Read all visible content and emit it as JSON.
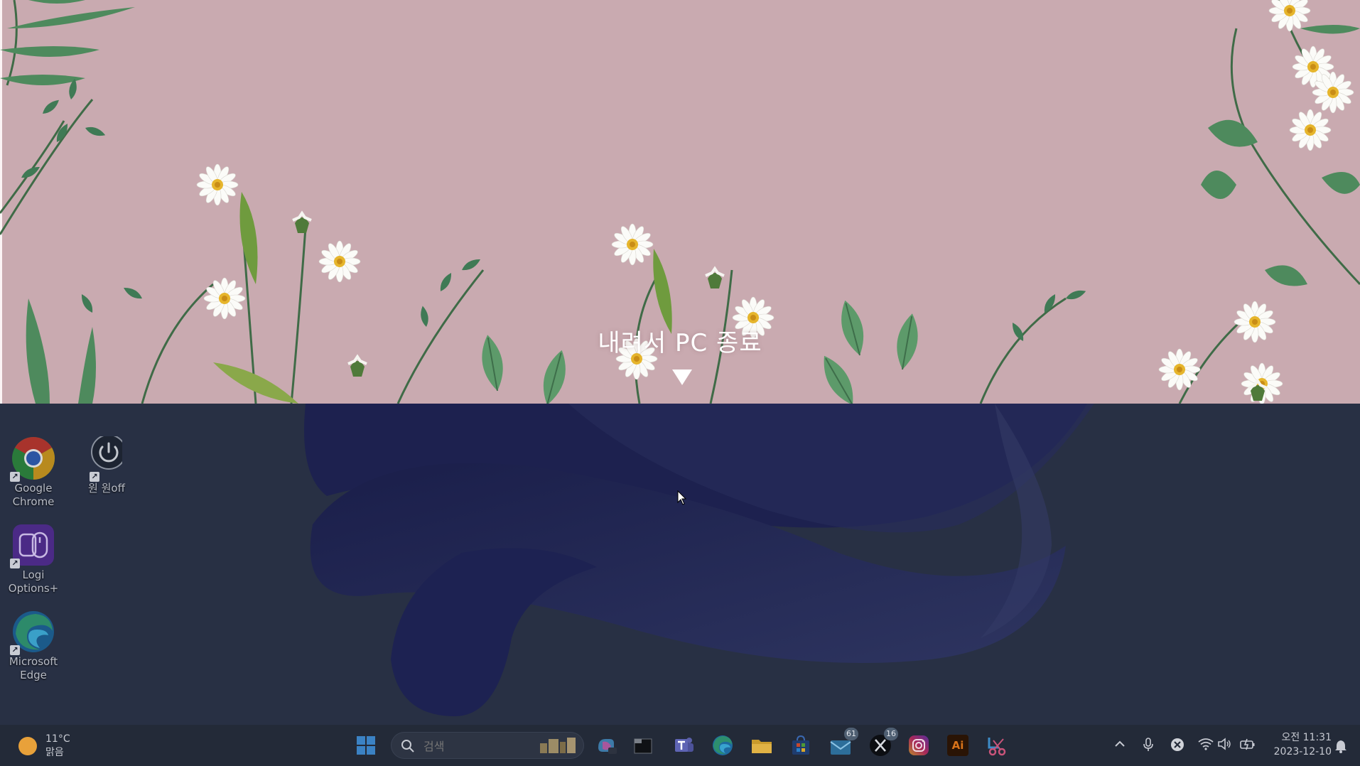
{
  "slide_to_shutdown": {
    "prompt": "내려서 PC 종료"
  },
  "desktop": {
    "icons": [
      {
        "label": "Google Chrome",
        "icon": "chrome-icon"
      },
      {
        "label": "원 원off",
        "icon": "power-icon"
      },
      {
        "label": "Logi Options+",
        "icon": "logi-options-icon"
      },
      {
        "label": "Microsoft Edge",
        "icon": "edge-icon"
      }
    ]
  },
  "taskbar": {
    "weather": {
      "temperature": "11°C",
      "condition": "맑음",
      "icon": "sun-icon"
    },
    "search_placeholder": "검색",
    "apps": [
      {
        "name": "start-button",
        "icon": "windows-logo-icon"
      },
      {
        "name": "copilot-button",
        "icon": "copilot-icon"
      },
      {
        "name": "terminal-button",
        "icon": "terminal-icon"
      },
      {
        "name": "teams-button",
        "icon": "teams-icon"
      },
      {
        "name": "edge-button",
        "icon": "edge-icon"
      },
      {
        "name": "file-explorer-button",
        "icon": "folder-icon"
      },
      {
        "name": "store-button",
        "icon": "store-icon"
      },
      {
        "name": "mail-button",
        "icon": "mail-icon",
        "badge": "61"
      },
      {
        "name": "x-button",
        "icon": "x-icon",
        "badge": "16"
      },
      {
        "name": "instagram-button",
        "icon": "instagram-icon"
      },
      {
        "name": "illustrator-button",
        "icon": "illustrator-icon",
        "label": "Ai"
      },
      {
        "name": "snipping-tool-button",
        "icon": "snipping-icon"
      }
    ],
    "tray": {
      "icons": [
        "chevron-up-icon",
        "microphone-icon",
        "close-circle-icon",
        "wifi-icon",
        "volume-icon",
        "battery-icon"
      ],
      "time": "오전 11:31",
      "date": "2023-12-10"
    }
  },
  "colors": {
    "lock_background": "#c9aab0",
    "desktop_background": "#283044",
    "taskbar_background": "#232a38"
  }
}
